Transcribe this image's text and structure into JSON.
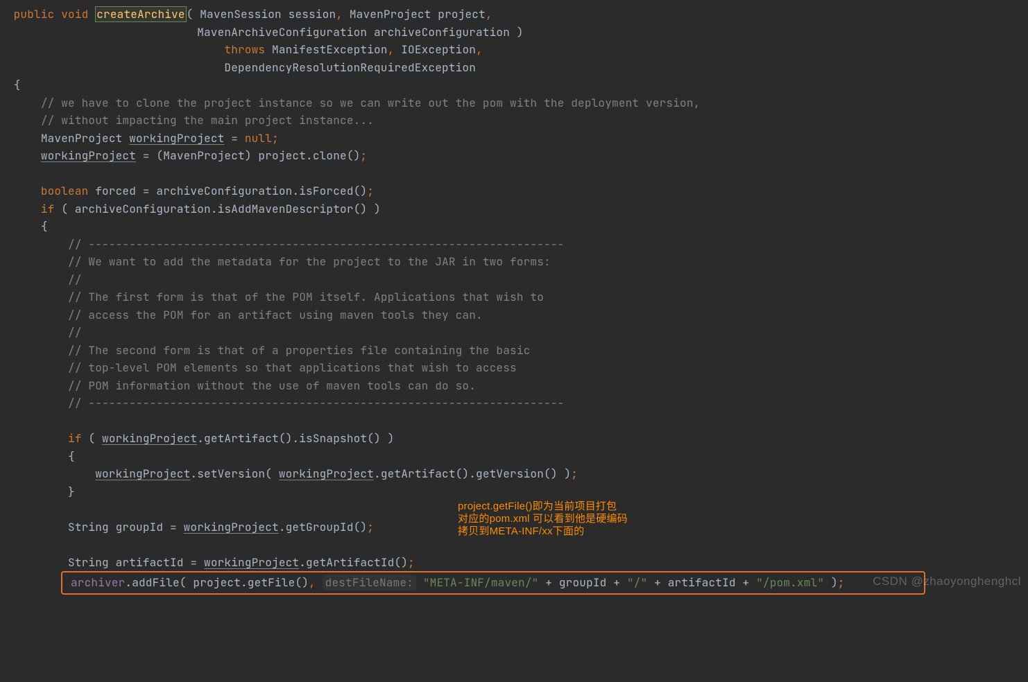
{
  "tokens": {
    "public": "public",
    "void": "void",
    "createArchive": "createArchive",
    "sigLine1": "( MavenSession session",
    "comma": ",",
    "sigParam2": " MavenProject project",
    "sigLine2": "MavenArchiveConfiguration archiveConfiguration )",
    "throws": "throws",
    "exc1": " ManifestException",
    "exc2": " IOException",
    "exc3": "DependencyResolutionRequiredException",
    "lbrace": "{",
    "rbrace": "}",
    "c1": "// we have to clone the project instance so we can write out the pom with the deployment version,",
    "c2": "// without impacting the main project instance...",
    "l3a": "MavenProject ",
    "workingProject": "workingProject",
    "l3b": " = ",
    "null": "null",
    "semi": ";",
    "l4b": " = (MavenProject) project.clone()",
    "boolean": "boolean",
    "l6a": " forced = archiveConfiguration.isForced()",
    "if": "if",
    "l7a": " ( archiveConfiguration.isAddMavenDescriptor() )",
    "c_dash": "// ----------------------------------------------------------------------",
    "c_a1": "// We want to add the metadata for the project to the JAR in two forms:",
    "c_a2": "//",
    "c_a3": "// The first form is that of the POM itself. Applications that wish to",
    "c_a4": "// access the POM for an artifact using maven tools they can.",
    "c_a5": "// The second form is that of a properties file containing the basic",
    "c_a6": "// top-level POM elements so that applications that wish to access",
    "c_a7": "// POM information without the use of maven tools can do so.",
    "l_if2": " ( ",
    "l_if2b": ".getArtifact().isSnapshot() )",
    "l_set1": ".setVersion( ",
    "l_set2": ".getArtifact().getVersion() )",
    "l_grp": "String groupId = ",
    "l_grp2": ".getGroupId()",
    "l_art": "String artifactId = ",
    "l_art2": ".getArtifactId()",
    "archiver": "archiver",
    "l_add1": ".addFile( project.getFile()",
    "hint": "destFileName:",
    "str1": "\"META-INF/maven/\"",
    "plus": " + ",
    "groupId": "groupId",
    "str2": "\"/\"",
    "artifactId": "artifactId",
    "str3": "\"/pom.xml\"",
    "closeParen": " )"
  },
  "callout": "project.getFile()即为当前项目打包\n对应的pom.xml 可以看到他是硬编码\n拷贝到META-INF/xx下面的",
  "watermark": "CSDN @zhaoyonghenghcl"
}
